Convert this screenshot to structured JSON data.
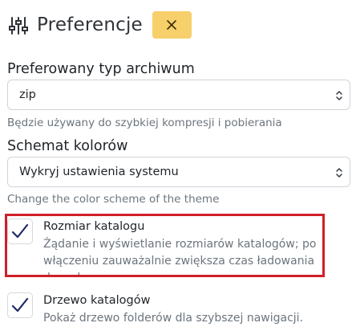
{
  "header": {
    "title": "Preferencje",
    "close_symbol": "×",
    "close_color": "#f7cf6b",
    "settings_icon": "sliders-icon"
  },
  "archive": {
    "label": "Preferowany typ archiwum",
    "value": "zip",
    "help": "Będzie używany do szybkiej kompresji i pobierania"
  },
  "color_scheme": {
    "label": "Schemat kolorów",
    "value": "Wykryj ustawienia systemu",
    "help": "Change the color scheme of the theme"
  },
  "dir_size": {
    "title": "Rozmiar katalogu",
    "desc": "Żądanie i wyświetlanie rozmiarów katalogów; po włączeniu zauważalnie zwiększa czas ładowania danych",
    "checked": true
  },
  "dir_tree": {
    "title": "Drzewo katalogów",
    "desc": "Pokaż drzewo folderów dla szybszej nawigacji.",
    "checked": true
  },
  "colors": {
    "highlight": "#d01f2a",
    "check": "#1f2a6b"
  }
}
